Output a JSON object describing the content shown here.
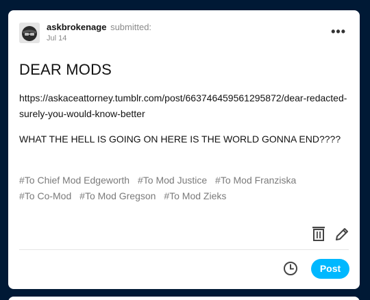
{
  "post": {
    "username": "askbrokenage",
    "submitted_label": "submitted:",
    "date": "Jul 14",
    "more_label": "•••",
    "title": "DEAR MODS",
    "link": "https://askaceattorney.tumblr.com/post/663746459561295872/dear-redacted-surely-you-would-know-better",
    "body": "WHAT THE HELL IS GOING ON HERE IS THE WORLD GONNA END????",
    "tags": [
      "#To Chief Mod Edgeworth",
      "#To Mod Justice",
      "#To Mod Franziska",
      "#To Co-Mod",
      "#To Mod Gregson",
      "#To Mod Zieks"
    ]
  },
  "actions": {
    "post_label": "Post",
    "icons": {
      "more": "more-options-icon",
      "delete": "trash-icon",
      "edit": "pencil-icon",
      "schedule": "clock-icon"
    }
  },
  "colors": {
    "background": "#001935",
    "card": "#ffffff",
    "accent": "#00b8ff",
    "tag_text": "#7a7a7a"
  }
}
